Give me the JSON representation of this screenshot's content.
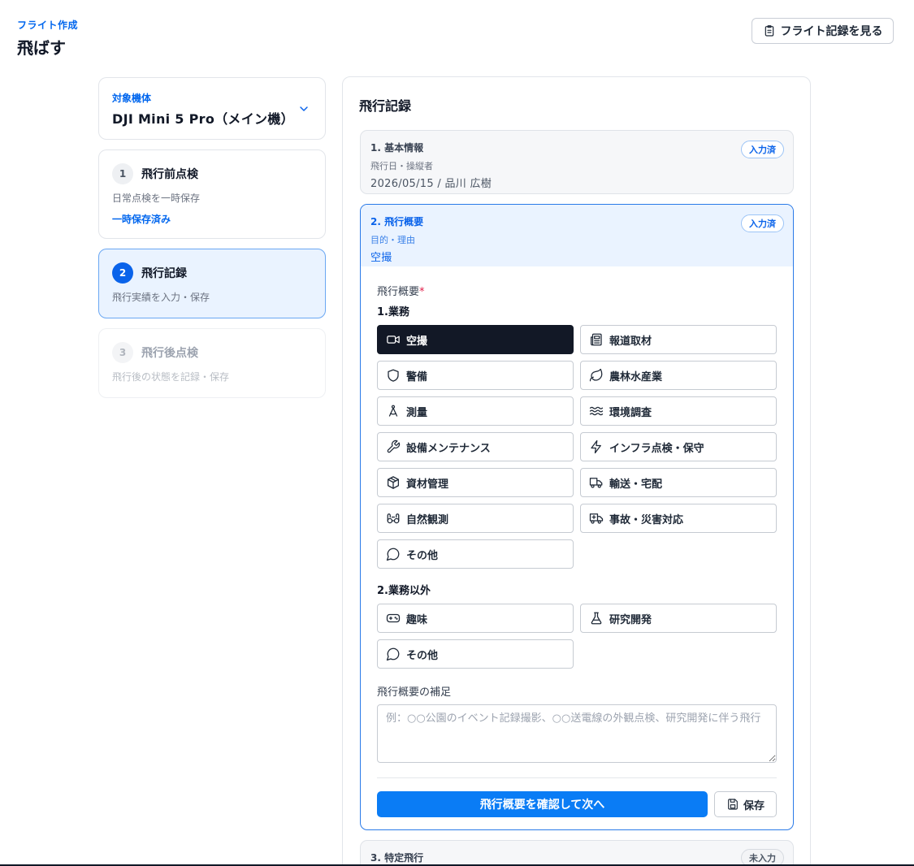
{
  "header": {
    "breadcrumb": "フライト作成",
    "title": "飛ばす",
    "records_button": "フライト記録を見る"
  },
  "aircraft": {
    "label": "対象機体",
    "value": "DJI Mini 5 Pro（メイン機）"
  },
  "steps": [
    {
      "num": "1",
      "title": "飛行前点検",
      "desc": "日常点検を一時保存",
      "status": "一時保存済み"
    },
    {
      "num": "2",
      "title": "飛行記録",
      "desc": "飛行実績を入力・保存"
    },
    {
      "num": "3",
      "title": "飛行後点検",
      "desc": "飛行後の状態を記録・保存"
    }
  ],
  "panel": {
    "title": "飛行記録",
    "sections": [
      {
        "title": "1. 基本情報",
        "sub": "飛行日・操縦者",
        "value": "2026/05/15 / 品川 広樹",
        "badge": "入力済"
      },
      {
        "title": "2. 飛行概要",
        "sub": "目的・理由",
        "value": "空撮",
        "badge": "入力済"
      },
      {
        "title": "3. 特定飛行",
        "badge": "未入力"
      }
    ]
  },
  "form": {
    "label": "飛行概要",
    "required_mark": "*",
    "group1_label": "1.業務",
    "group1_options": [
      {
        "label": "空撮",
        "icon": "video-camera-icon",
        "selected": true
      },
      {
        "label": "報道取材",
        "icon": "newspaper-icon",
        "selected": false
      },
      {
        "label": "警備",
        "icon": "shield-icon",
        "selected": false
      },
      {
        "label": "農林水産業",
        "icon": "leaf-icon",
        "selected": false
      },
      {
        "label": "測量",
        "icon": "compass-icon",
        "selected": false
      },
      {
        "label": "環境調査",
        "icon": "waves-icon",
        "selected": false
      },
      {
        "label": "設備メンテナンス",
        "icon": "wrench-icon",
        "selected": false
      },
      {
        "label": "インフラ点検・保守",
        "icon": "lightning-icon",
        "selected": false
      },
      {
        "label": "資材管理",
        "icon": "package-icon",
        "selected": false
      },
      {
        "label": "輸送・宅配",
        "icon": "truck-icon",
        "selected": false
      },
      {
        "label": "自然観測",
        "icon": "binoculars-icon",
        "selected": false
      },
      {
        "label": "事故・災害対応",
        "icon": "ambulance-icon",
        "selected": false
      },
      {
        "label": "その他",
        "icon": "chat-bubble-icon",
        "selected": false
      }
    ],
    "group2_label": "2.業務以外",
    "group2_options": [
      {
        "label": "趣味",
        "icon": "gamepad-icon",
        "selected": false
      },
      {
        "label": "研究開発",
        "icon": "flask-icon",
        "selected": false
      },
      {
        "label": "その他",
        "icon": "chat-bubble-icon",
        "selected": false
      }
    ],
    "supplement_label": "飛行概要の補足",
    "supplement_placeholder": "例：○○公園のイベント記録撮影、○○送電線の外観点検、研究開発に伴う飛行",
    "supplement_value": "",
    "next_button": "飛行概要を確認して次へ",
    "save_button": "保存"
  }
}
